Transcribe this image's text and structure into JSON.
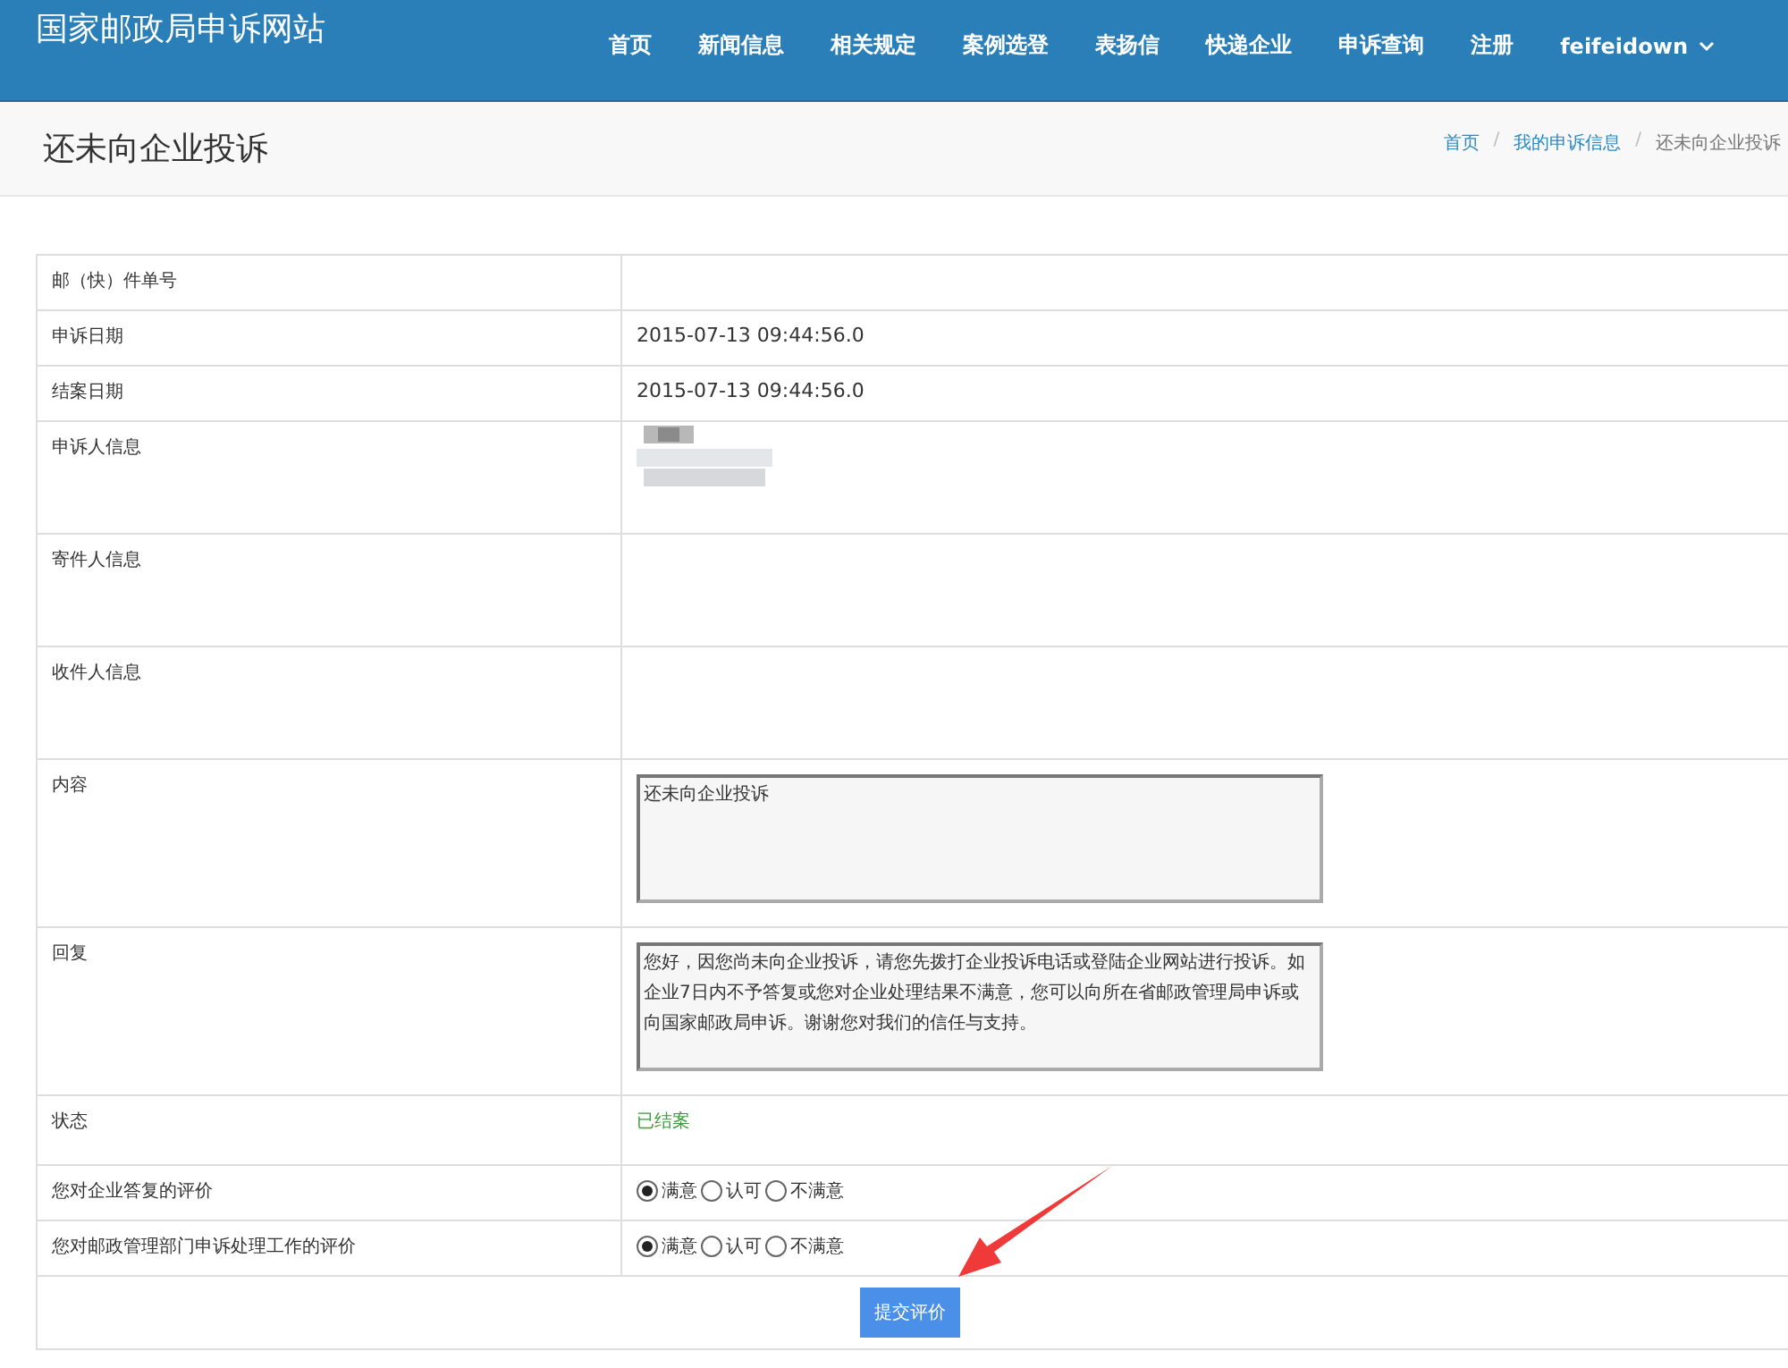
{
  "navbar": {
    "brand": "国家邮政局申诉网站",
    "links": [
      {
        "label": "首页"
      },
      {
        "label": "新闻信息"
      },
      {
        "label": "相关规定"
      },
      {
        "label": "案例选登"
      },
      {
        "label": "表扬信"
      },
      {
        "label": "快递企业"
      },
      {
        "label": "申诉查询"
      },
      {
        "label": "注册"
      }
    ],
    "user": "feifeidown"
  },
  "page_header": {
    "title": "还未向企业投诉",
    "separator": "/",
    "breadcrumb": [
      {
        "label": "首页",
        "kind": "link"
      },
      {
        "label": "我的申诉信息",
        "kind": "link"
      },
      {
        "label": "还未向企业投诉",
        "kind": "current"
      }
    ]
  },
  "rows": [
    {
      "kind": "text",
      "label": "邮（快）件单号"
    },
    {
      "kind": "text",
      "label": "申诉日期",
      "value": "2015-07-13 09:44:56.0"
    },
    {
      "kind": "text",
      "label": "结案日期",
      "value": "2015-07-13 09:44:56.0"
    },
    {
      "kind": "blurred",
      "label": "申诉人信息"
    },
    {
      "kind": "blank",
      "label": "寄件人信息"
    },
    {
      "kind": "blank",
      "label": "收件人信息"
    },
    {
      "kind": "textarea",
      "label": "内容",
      "value": "还未向企业投诉"
    },
    {
      "kind": "textarea",
      "label": "回复",
      "value": "您好，因您尚未向企业投诉，请您先拨打企业投诉电话或登陆企业网站进行投诉。如企业7日内不予答复或您对企业处理结果不满意，您可以向所在省邮政管理局申诉或向国家邮政局申诉。谢谢您对我们的信任与支持。"
    },
    {
      "kind": "status",
      "label": "状态",
      "value": "已结案"
    },
    {
      "kind": "rating",
      "label": "您对企业答复的评价",
      "options": [
        {
          "label": "满意",
          "selected": true
        },
        {
          "label": "认可",
          "selected": false
        },
        {
          "label": "不满意",
          "selected": false
        }
      ]
    },
    {
      "kind": "rating",
      "label": "您对邮政管理部门申诉处理工作的评价",
      "options": [
        {
          "label": "满意",
          "selected": true
        },
        {
          "label": "认可",
          "selected": false
        },
        {
          "label": "不满意",
          "selected": false
        }
      ]
    }
  ],
  "submit_button": "提交评价"
}
